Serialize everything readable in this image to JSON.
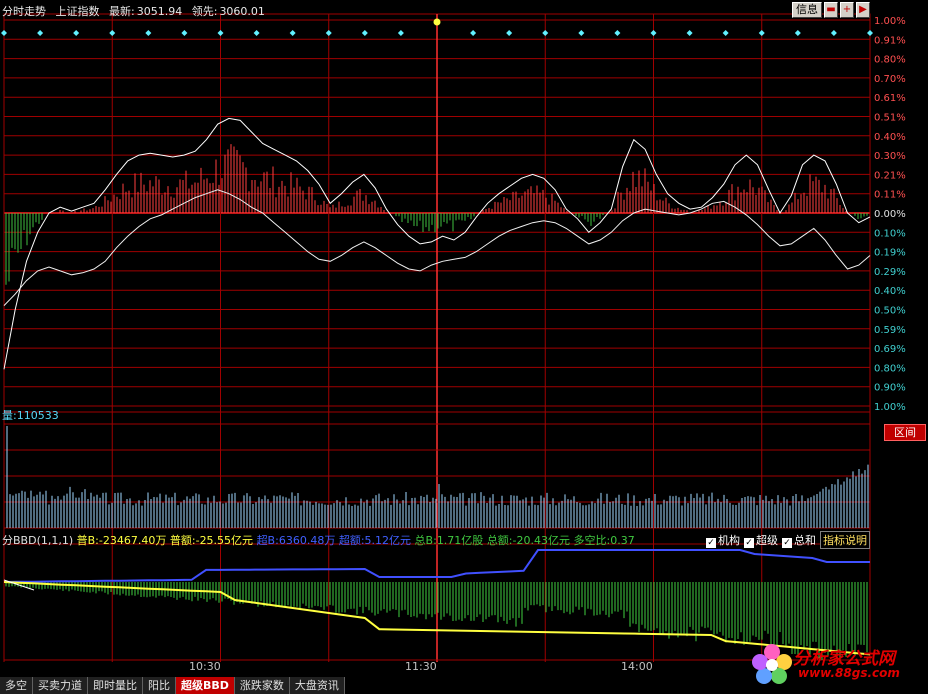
{
  "header": {
    "mode": "分时走势",
    "index_name": "上证指数",
    "latest_label": "最新:",
    "latest_value": "3051.94",
    "lead_label": "领先:",
    "lead_value": "3060.01",
    "info_button": "信息"
  },
  "pct_axis": {
    "upper": [
      "1.00%",
      "0.91%",
      "0.80%",
      "0.70%",
      "0.61%",
      "0.51%",
      "0.40%",
      "0.30%",
      "0.21%",
      "0.11%"
    ],
    "zero": "0.00%",
    "lower": [
      "0.10%",
      "0.19%",
      "0.29%",
      "0.40%",
      "0.50%",
      "0.59%",
      "0.69%",
      "0.80%",
      "0.90%",
      "1.00%"
    ]
  },
  "volume": {
    "label": "量:",
    "value": "110533",
    "zone_button": "区间"
  },
  "bbd": {
    "name": "分BBD(1,1,1)",
    "pu_b_label": "普B:",
    "pu_b_value": "-23467.40万",
    "pu_e_label": "普额:",
    "pu_e_value": "-25.55亿元",
    "chao_b_label": "超B:",
    "chao_b_value": "6360.48万",
    "chao_e_label": "超额:",
    "chao_e_value": "5.12亿元",
    "zong_b_label": "总B:",
    "zong_b_value": "1.71亿股",
    "zong_e_label": "总额:",
    "zong_e_value": "-20.43亿元",
    "ratio_label": "多空比:",
    "ratio_value": "0.37",
    "check_institution": "机构",
    "check_super": "超级",
    "check_total": "总和",
    "explain_button": "指标说明"
  },
  "time_axis": [
    "10:30",
    "11:30",
    "14:00"
  ],
  "tabs": [
    "多空",
    "买卖力道",
    "即时量比",
    "阳比",
    "超级BBD",
    "涨跌家数",
    "大盘资讯"
  ],
  "active_tab": "超级BBD",
  "logo": {
    "line1": "分析家公式网",
    "line2": "www.88gs.com"
  },
  "colors": {
    "grid": "#a00000",
    "up_bar": "#ff4040",
    "down_bar": "#40c040",
    "price_line": "#ffffff",
    "avg_line": "#ffff60",
    "vol_bar": "#a0d8ff",
    "bbd_blue": "#4050ff",
    "bbd_yellow": "#ffff40",
    "bbd_green": "#40d040"
  },
  "chart_data": {
    "type": "line",
    "series": [
      {
        "values": [
          -0.81,
          -0.5,
          -0.25,
          -0.1,
          0.0,
          0.03,
          0.01,
          0.03,
          0.05,
          0.12,
          0.2,
          0.27,
          0.3,
          0.31,
          0.3,
          0.29,
          0.3,
          0.32,
          0.38,
          0.46,
          0.49,
          0.48,
          0.42,
          0.36,
          0.33,
          0.3,
          0.27,
          0.22,
          0.15,
          0.05,
          0.1,
          0.16,
          0.2,
          0.13,
          0.02,
          -0.06,
          -0.12,
          -0.16,
          -0.15,
          -0.12,
          -0.14,
          -0.1,
          -0.02,
          0.05,
          0.1,
          0.14,
          0.18,
          0.2,
          0.18,
          0.12,
          0.02,
          -0.03,
          -0.1,
          -0.05,
          0.02,
          0.24,
          0.38,
          0.33,
          0.2,
          0.1,
          0.05,
          0.02,
          0.03,
          0.08,
          0.15,
          0.25,
          0.3,
          0.25,
          0.12,
          0.0,
          0.09,
          0.25,
          0.3,
          0.27,
          0.15,
          0.0,
          -0.05,
          -0.02
        ]
      },
      {
        "values": [
          -0.48,
          -0.42,
          -0.35,
          -0.3,
          -0.28,
          -0.3,
          -0.32,
          -0.31,
          -0.29,
          -0.25,
          -0.18,
          -0.12,
          -0.07,
          -0.03,
          -0.01,
          0.02,
          0.05,
          0.08,
          0.1,
          0.12,
          0.1,
          0.07,
          0.03,
          0.0,
          -0.05,
          -0.1,
          -0.15,
          -0.2,
          -0.24,
          -0.25,
          -0.22,
          -0.18,
          -0.15,
          -0.18,
          -0.22,
          -0.26,
          -0.29,
          -0.3,
          -0.27,
          -0.25,
          -0.24,
          -0.23,
          -0.2,
          -0.16,
          -0.12,
          -0.09,
          -0.07,
          -0.05,
          -0.04,
          -0.05,
          -0.08,
          -0.12,
          -0.16,
          -0.14,
          -0.1,
          -0.04,
          0.0,
          0.02,
          0.01,
          0.0,
          -0.01,
          0.0,
          0.02,
          0.05,
          0.06,
          0.03,
          -0.01,
          -0.06,
          -0.12,
          -0.17,
          -0.16,
          -0.12,
          -0.08,
          -0.14,
          -0.22,
          -0.29,
          -0.27,
          -0.22
        ]
      }
    ],
    "ylim": [
      -1.0,
      1.0
    ]
  }
}
